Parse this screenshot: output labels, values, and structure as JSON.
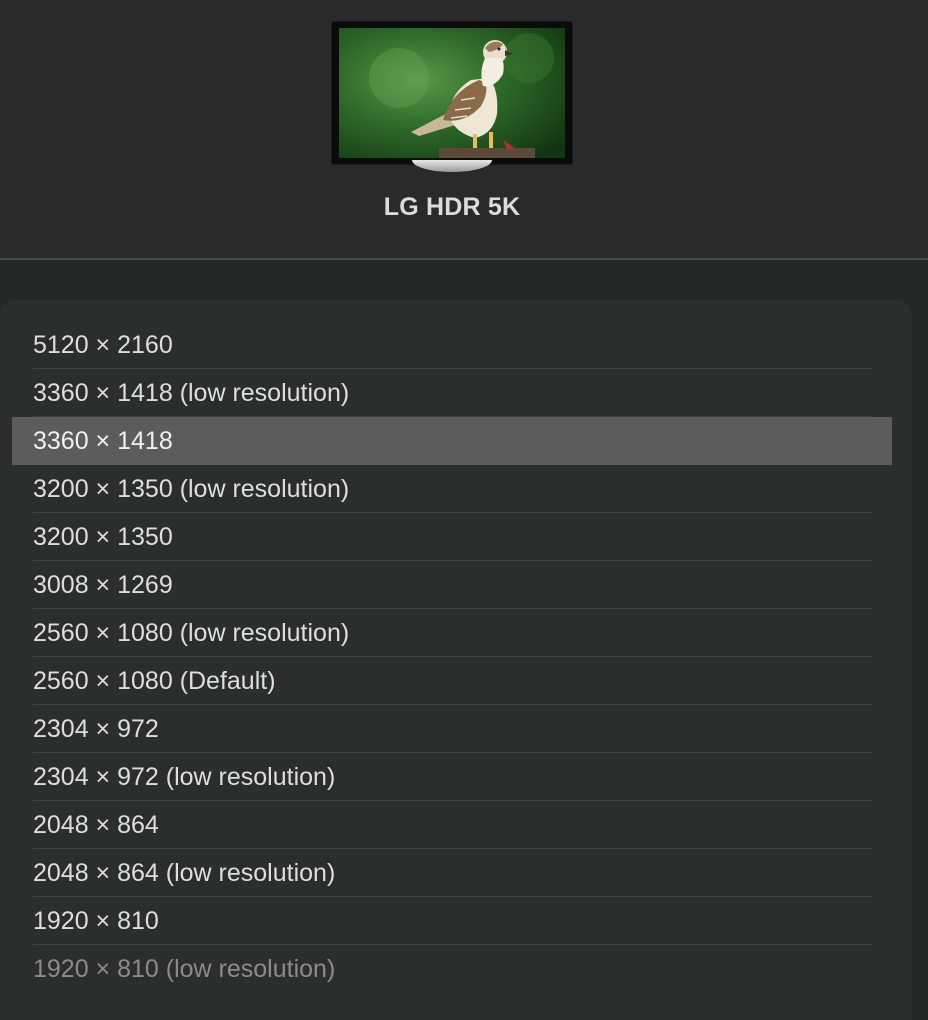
{
  "display": {
    "name": "LG HDR 5K",
    "thumbnail_icon": "monitor-wallpaper-hawk"
  },
  "resolutions": [
    {
      "label": "5120 × 2160",
      "selected": false
    },
    {
      "label": "3360 × 1418 (low resolution)",
      "selected": false
    },
    {
      "label": "3360 × 1418",
      "selected": true
    },
    {
      "label": "3200 × 1350 (low resolution)",
      "selected": false
    },
    {
      "label": "3200 × 1350",
      "selected": false
    },
    {
      "label": "3008 × 1269",
      "selected": false
    },
    {
      "label": "2560 × 1080 (low resolution)",
      "selected": false
    },
    {
      "label": "2560 × 1080 (Default)",
      "selected": false
    },
    {
      "label": "2304 × 972",
      "selected": false
    },
    {
      "label": "2304 × 972 (low resolution)",
      "selected": false
    },
    {
      "label": "2048 × 864",
      "selected": false
    },
    {
      "label": "2048 × 864 (low resolution)",
      "selected": false
    },
    {
      "label": "1920 × 810",
      "selected": false
    },
    {
      "label": "1920 × 810 (low resolution)",
      "selected": false
    }
  ],
  "colors": {
    "selected_row": "#5b5d5a",
    "panel_background": "#2b2f2c",
    "header_background": "#2a2a2a"
  }
}
